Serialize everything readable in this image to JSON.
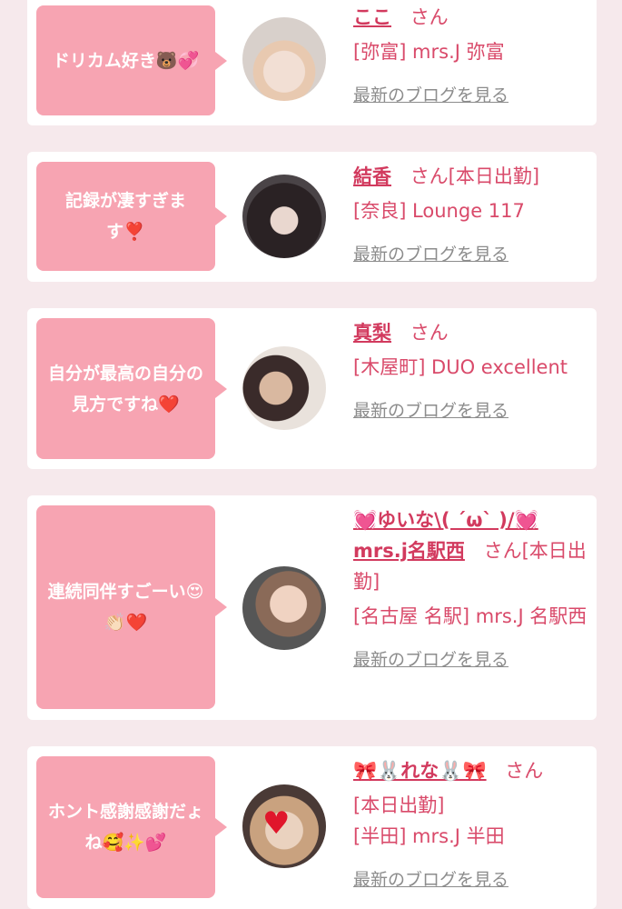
{
  "cards": [
    {
      "comment": "ドリカム好き🐻💞",
      "name": "ここ",
      "san": "さん",
      "shop": "[弥富] mrs.J 弥富",
      "blog": "最新のブログを見る"
    },
    {
      "comment": "記録が凄すぎます❣️",
      "name": "結香",
      "san": "さん[本日出勤]",
      "shop": "[奈良] Lounge 117",
      "blog": "最新のブログを見る"
    },
    {
      "comment": "自分が最高の自分の見方ですね❤️",
      "name": "真梨",
      "san": "さん",
      "shop": "[木屋町] DUO excellent",
      "blog": "最新のブログを見る"
    },
    {
      "comment": "連続同伴すごーい😍👏🏻❤️",
      "name": "💓ゆいな\\( ´ω` )/💓mrs.j名駅西",
      "san": "さん[本日出勤]",
      "shop": "[名古屋 名駅] mrs.J 名駅西",
      "blog": "最新のブログを見る"
    },
    {
      "comment": "ホント感謝感謝だょね🥰✨💕",
      "name": "🎀🐰れな🐰🎀",
      "san": "さん",
      "status": "[本日出勤]",
      "shop": "[半田] mrs.J 半田",
      "blog": "最新のブログを見る"
    }
  ],
  "colors": {
    "bubble": "#f7a4b2",
    "name": "#d23a5e",
    "shop": "#d94a6a",
    "blog": "#8c8c8c",
    "background": "#f6e9ec"
  }
}
